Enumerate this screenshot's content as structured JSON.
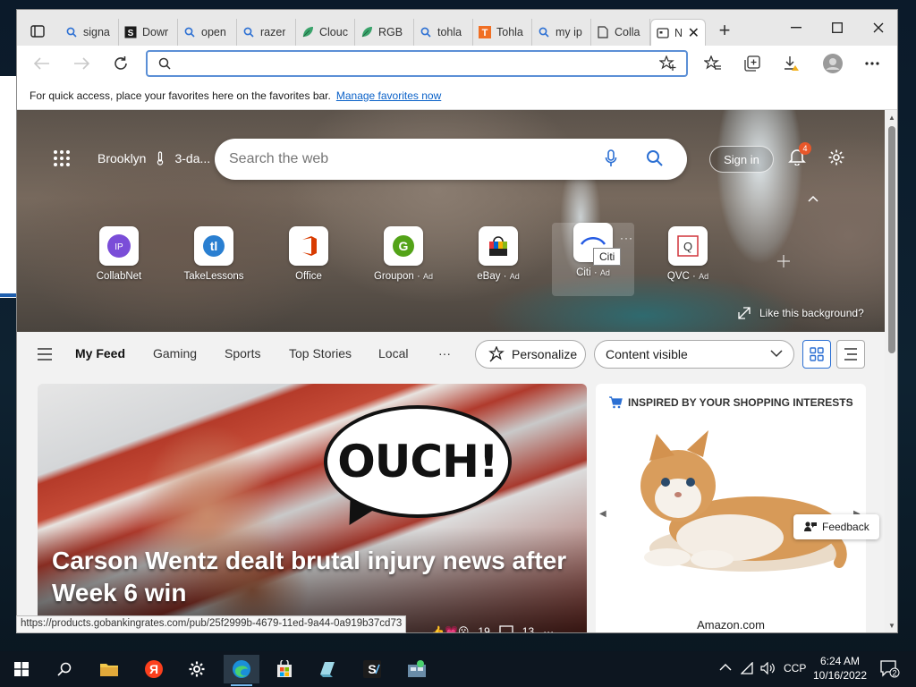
{
  "window": {
    "tabs": [
      {
        "title": "signa",
        "icon": "search-icon"
      },
      {
        "title": "Dowr",
        "icon": "app-icon"
      },
      {
        "title": "open",
        "icon": "search-icon"
      },
      {
        "title": "razer",
        "icon": "search-icon"
      },
      {
        "title": "Clouc",
        "icon": "leaf-icon"
      },
      {
        "title": "RGB",
        "icon": "leaf-icon"
      },
      {
        "title": "tohla",
        "icon": "search-icon"
      },
      {
        "title": "Tohla",
        "icon": "t-logo-icon"
      },
      {
        "title": "my ip",
        "icon": "search-icon"
      },
      {
        "title": "Colla",
        "icon": "page-icon"
      },
      {
        "title": "N",
        "icon": "newtab-icon"
      }
    ],
    "address": {
      "value": "",
      "placeholder": ""
    },
    "favorites_bar": {
      "text": "For quick access, place your favorites here on the favorites bar.",
      "link": "Manage favorites now"
    }
  },
  "hero": {
    "location": "Brooklyn",
    "weather": "3-da...",
    "search_placeholder": "Search the web",
    "signin": "Sign in",
    "notifications": "4",
    "like_background": "Like this background?",
    "tooltip": "Citi",
    "quick_links": [
      {
        "label": "CollabNet",
        "ad": "",
        "tile_text": "IP",
        "color": "#7a4dd8"
      },
      {
        "label": "TakeLessons",
        "ad": "",
        "tile_text": "tl",
        "color": "#2a7fd1"
      },
      {
        "label": "Office",
        "ad": "",
        "tile_text": "O",
        "color": "#d83b01"
      },
      {
        "label": "Groupon",
        "ad": "Ad",
        "tile_text": "G",
        "color": "#53a318"
      },
      {
        "label": "eBay",
        "ad": "Ad",
        "tile_text": "e",
        "color": "#e53238"
      },
      {
        "label": "Citi",
        "ad": "Ad",
        "tile_text": "",
        "color": "#255be3"
      },
      {
        "label": "QVC",
        "ad": "Ad",
        "tile_text": "Q",
        "color": "#d0343a"
      }
    ]
  },
  "feed": {
    "tabs": [
      "My Feed",
      "Gaming",
      "Sports",
      "Top Stories",
      "Local"
    ],
    "more": "···",
    "personalize": "Personalize",
    "content_visible": "Content visible"
  },
  "article": {
    "bubble_text": "OUCH!",
    "headline": "Carson Wentz dealt brutal injury news after Week 6 win",
    "likes": "19",
    "comments": "13"
  },
  "shopping": {
    "header": "INSPIRED BY YOUR SHOPPING INTERESTS",
    "store": "Amazon.com",
    "feedback": "Feedback"
  },
  "status_url": "https://products.gobankingrates.com/pub/25f2999b-4679-11ed-9a44-0a919b37cd73",
  "taskbar": {
    "tray_lang": "CCP",
    "time": "6:24 AM",
    "date": "10/16/2022",
    "notif_count": "2"
  },
  "colors": {
    "accent": "#2b6fd3",
    "link": "#0a61c8",
    "badge": "#e8572a"
  }
}
